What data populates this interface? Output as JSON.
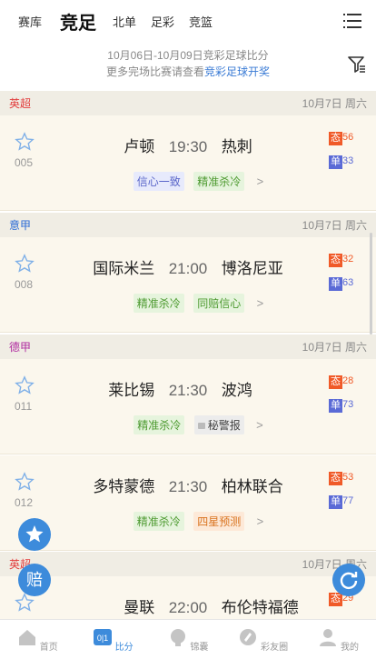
{
  "nav": {
    "tabs": [
      "赛库",
      "竞足",
      "北单",
      "足彩",
      "竞篮"
    ],
    "active_tab": "竞足"
  },
  "info": {
    "line1": "10月06日-10月09日竞彩足球比分",
    "line2_prefix": "更多完场比赛请查看",
    "line2_link": "竞彩足球开奖"
  },
  "leagues": [
    {
      "name": "英超",
      "color": "#e23c3c",
      "date": "10月7日 周六"
    },
    {
      "name": "意甲",
      "color": "#2b6bd6",
      "date": "10月7日 周六"
    },
    {
      "name": "德甲",
      "color": "#b02ca0",
      "date": "10月7日 周六"
    },
    {
      "name": "英超",
      "color": "#e23c3c",
      "date": "10月7日 周六"
    }
  ],
  "matches": [
    {
      "num": "005",
      "home": "卢顿",
      "time": "19:30",
      "away": "热刺",
      "tags": [
        "信心一致",
        "精准杀冷"
      ],
      "tai_label": "态",
      "tai_val": "56",
      "dan_label": "单",
      "dan_val": "33"
    },
    {
      "num": "008",
      "home": "国际米兰",
      "time": "21:00",
      "away": "博洛尼亚",
      "tags": [
        "精准杀冷",
        "同赔信心"
      ],
      "tai_label": "态",
      "tai_val": "32",
      "dan_label": "单",
      "dan_val": "63"
    },
    {
      "num": "011",
      "home": "莱比锡",
      "time": "21:30",
      "away": "波鸿",
      "tags": [
        "精准杀冷",
        "秘警报"
      ],
      "tai_label": "态",
      "tai_val": "28",
      "dan_label": "单",
      "dan_val": "73"
    },
    {
      "num": "012",
      "home": "多特蒙德",
      "time": "21:30",
      "away": "柏林联合",
      "tags": [
        "精准杀冷",
        "四星预测"
      ],
      "tai_label": "态",
      "tai_val": "53",
      "dan_label": "单",
      "dan_val": "77"
    },
    {
      "num": "",
      "home": "曼联",
      "time": "22:00",
      "away": "布伦特福德",
      "tags": [],
      "tai_label": "态",
      "tai_val": "29",
      "dan_label": "单",
      "dan_val": ""
    }
  ],
  "floating": {
    "bet_label": "赔"
  },
  "bottom_nav": [
    "首页",
    "比分",
    "锦囊",
    "彩友圈",
    "我的"
  ],
  "bottom_active": "比分",
  "colors": {
    "accent": "#3d8bdb"
  }
}
